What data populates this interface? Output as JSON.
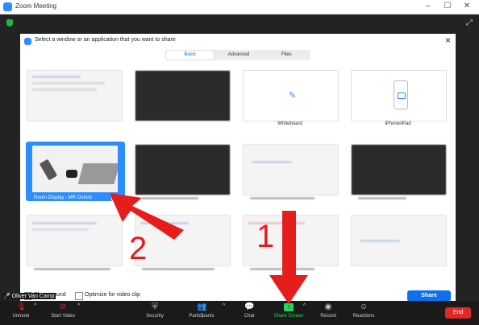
{
  "window": {
    "title": "Zoom Meeting"
  },
  "dialog": {
    "title": "Select a window or an application that you want to share",
    "tabs": [
      {
        "label": "Basic",
        "active": true
      },
      {
        "label": "Advanced"
      },
      {
        "label": "Files"
      }
    ],
    "tiles": [
      {
        "caption": "",
        "kind": "window"
      },
      {
        "caption": "",
        "kind": "window-dark"
      },
      {
        "caption": "Whiteboard",
        "kind": "whiteboard",
        "icon": "pencil-icon"
      },
      {
        "caption": "iPhone/iPad",
        "kind": "ipad",
        "icon": "ipad-icon"
      },
      {
        "caption": "Room Display - MR Oxford",
        "kind": "room",
        "selected": true
      },
      {
        "caption": "",
        "kind": "window-dark"
      },
      {
        "caption": "",
        "kind": "window"
      },
      {
        "caption": "",
        "kind": "window-dark"
      },
      {
        "caption": "",
        "kind": "window"
      },
      {
        "caption": "",
        "kind": "window"
      },
      {
        "caption": "",
        "kind": "window"
      },
      {
        "caption": "",
        "kind": "window"
      }
    ],
    "footer": {
      "share_sound": "Share sound",
      "optimize": "Optimize for video clip",
      "share_button": "Share"
    }
  },
  "participant_name": "Oliver Van Camp",
  "annotations": {
    "step1": "1",
    "step2": "2",
    "arrow_color": "#e51d1d"
  },
  "toolbar": {
    "unmute": "Unmute",
    "start_video": "Start Video",
    "security": "Security",
    "participants": "Participants",
    "participants_count": "1",
    "chat": "Chat",
    "share_screen": "Share Screen",
    "record": "Record",
    "reactions": "Reactions",
    "end": "End"
  },
  "colors": {
    "accent": "#2d8cff",
    "share_green": "#23d959",
    "end_red": "#e02828"
  }
}
